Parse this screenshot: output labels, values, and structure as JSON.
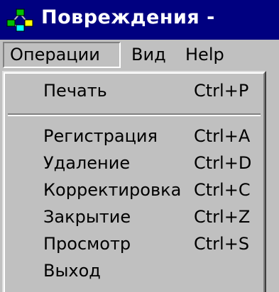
{
  "window": {
    "title": "Повреждения -",
    "icon": "network-tree-icon"
  },
  "menubar": {
    "items": [
      {
        "label": "Операции",
        "active": true
      },
      {
        "label": "Вид"
      },
      {
        "label": "Help"
      }
    ]
  },
  "dropdown": {
    "items": [
      {
        "label": "Печать",
        "shortcut": "Ctrl+P"
      },
      {
        "label": "Регистрация",
        "shortcut": "Ctrl+A"
      },
      {
        "label": "Удаление",
        "shortcut": "Ctrl+D"
      },
      {
        "label": "Корректировка",
        "shortcut": "Ctrl+C"
      },
      {
        "label": "Закрытие",
        "shortcut": "Ctrl+Z"
      },
      {
        "label": "Просмотр",
        "shortcut": "Ctrl+S"
      },
      {
        "label": "Выход",
        "shortcut": ""
      }
    ]
  },
  "colors": {
    "titlebar": "#000080",
    "face": "#c0c0c0"
  }
}
